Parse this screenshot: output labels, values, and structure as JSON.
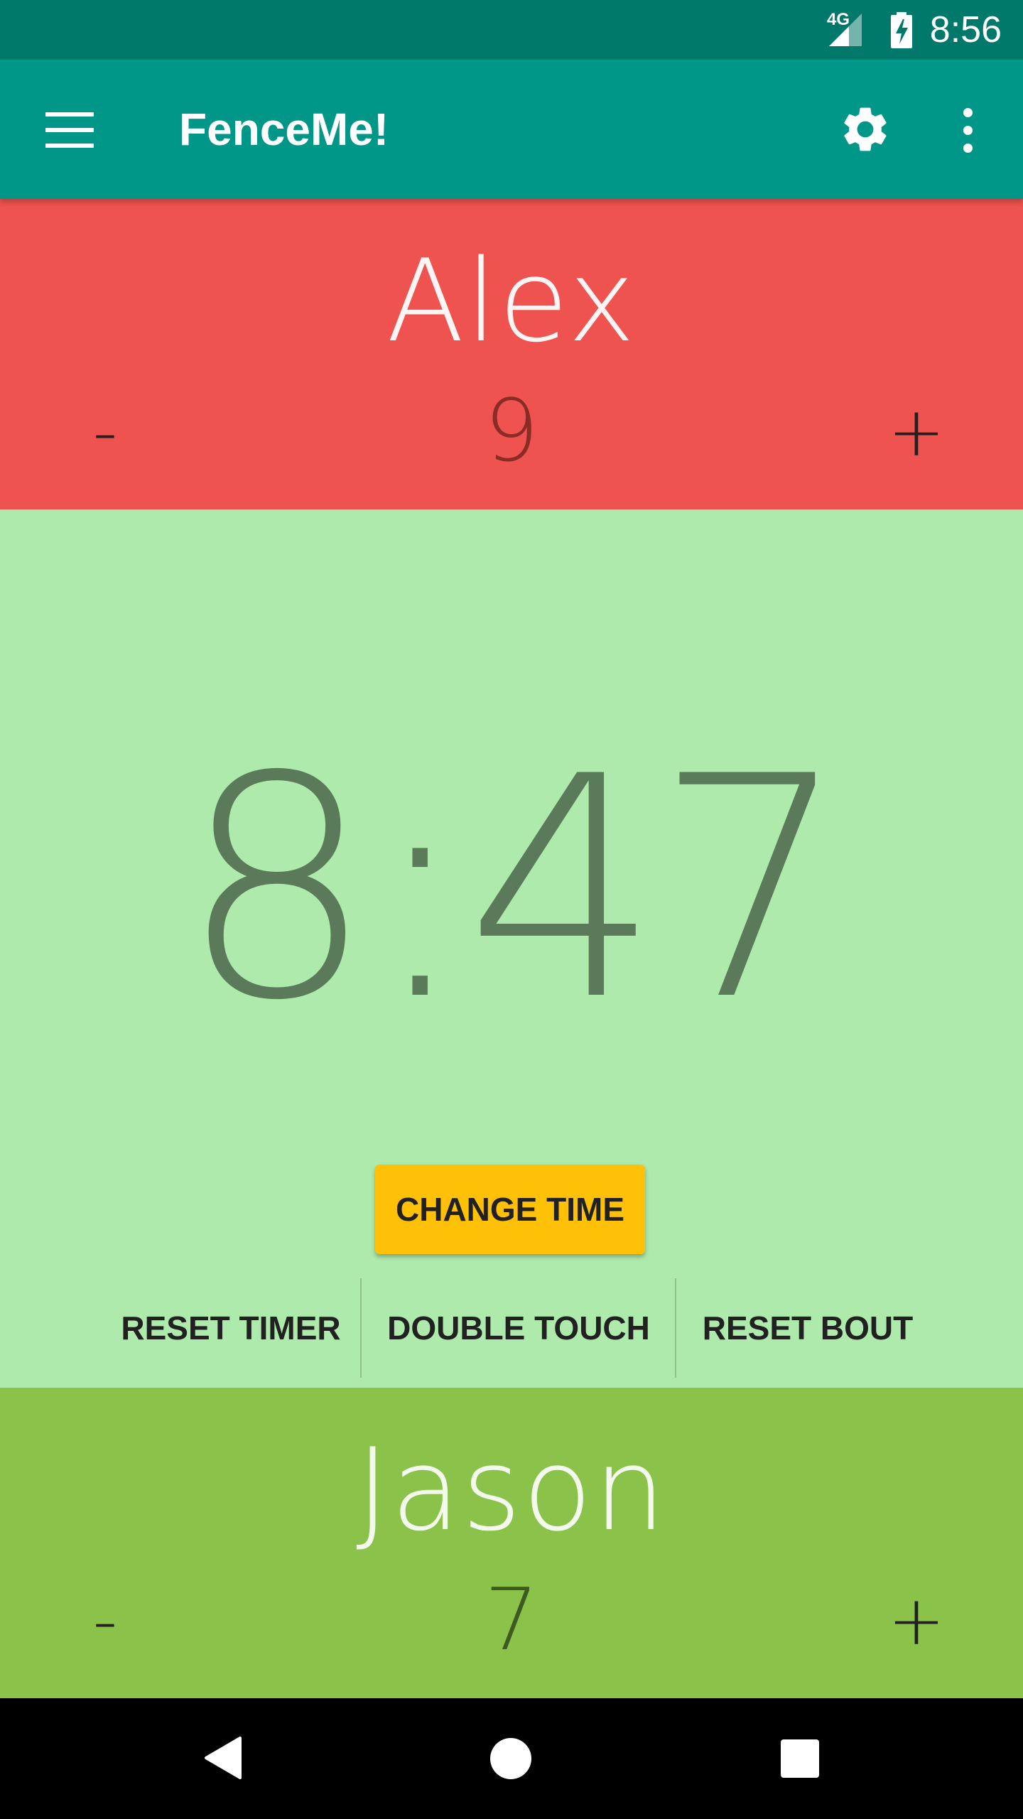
{
  "status_bar": {
    "time": "8:56",
    "network": "4G",
    "icons": [
      "signal-icon",
      "battery-charging-icon"
    ]
  },
  "app_bar": {
    "title": "FenceMe!",
    "icons": [
      "menu-icon",
      "settings-icon",
      "overflow-menu-icon"
    ]
  },
  "fencers": {
    "top": {
      "name": "Alex",
      "score": "9",
      "minus_label": "-",
      "plus_label": "+",
      "color": "#ef5350"
    },
    "bottom": {
      "name": "Jason",
      "score": "7",
      "minus_label": "-",
      "plus_label": "+",
      "color": "#8bc34a"
    }
  },
  "timer": {
    "display": "8:47",
    "background": "#aeeaab",
    "change_time_label": "CHANGE TIME",
    "actions": {
      "reset_timer": "RESET TIMER",
      "double_touch": "DOUBLE TOUCH",
      "reset_bout": "RESET BOUT"
    }
  },
  "colors": {
    "status_bar": "#00796b",
    "app_bar": "#009688",
    "accent": "#ffc107"
  },
  "nav_bar": {
    "icons": [
      "back-icon",
      "home-icon",
      "recents-icon"
    ]
  }
}
